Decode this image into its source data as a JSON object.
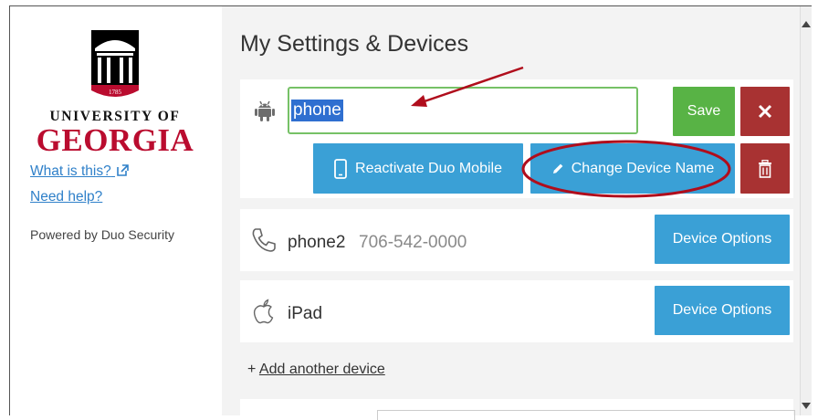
{
  "sidebar": {
    "logo_year": "1785",
    "logo_line1": "UNIVERSITY OF",
    "logo_line2": "GEORGIA",
    "what_is_this": "What is this?",
    "need_help": "Need help?",
    "powered_by": "Powered by Duo Security"
  },
  "main": {
    "title": "My Settings & Devices",
    "edit_device": {
      "input_value": "phone",
      "save_label": "Save",
      "reactivate_label": "Reactivate Duo Mobile",
      "change_name_label": "Change Device Name"
    },
    "devices": [
      {
        "name": "phone2",
        "number": "706-542-0000",
        "options_label": "Device Options",
        "icon": "phone-icon"
      },
      {
        "name": "iPad",
        "number": "",
        "options_label": "Device Options",
        "icon": "apple-icon"
      }
    ],
    "add_prefix": "+",
    "add_device_label": "Add another device"
  },
  "colors": {
    "green": "#58b345",
    "blue": "#3aa0d6",
    "red": "#a83232",
    "annotation": "#b00d1c",
    "georgia_red": "#ba0c2f"
  }
}
